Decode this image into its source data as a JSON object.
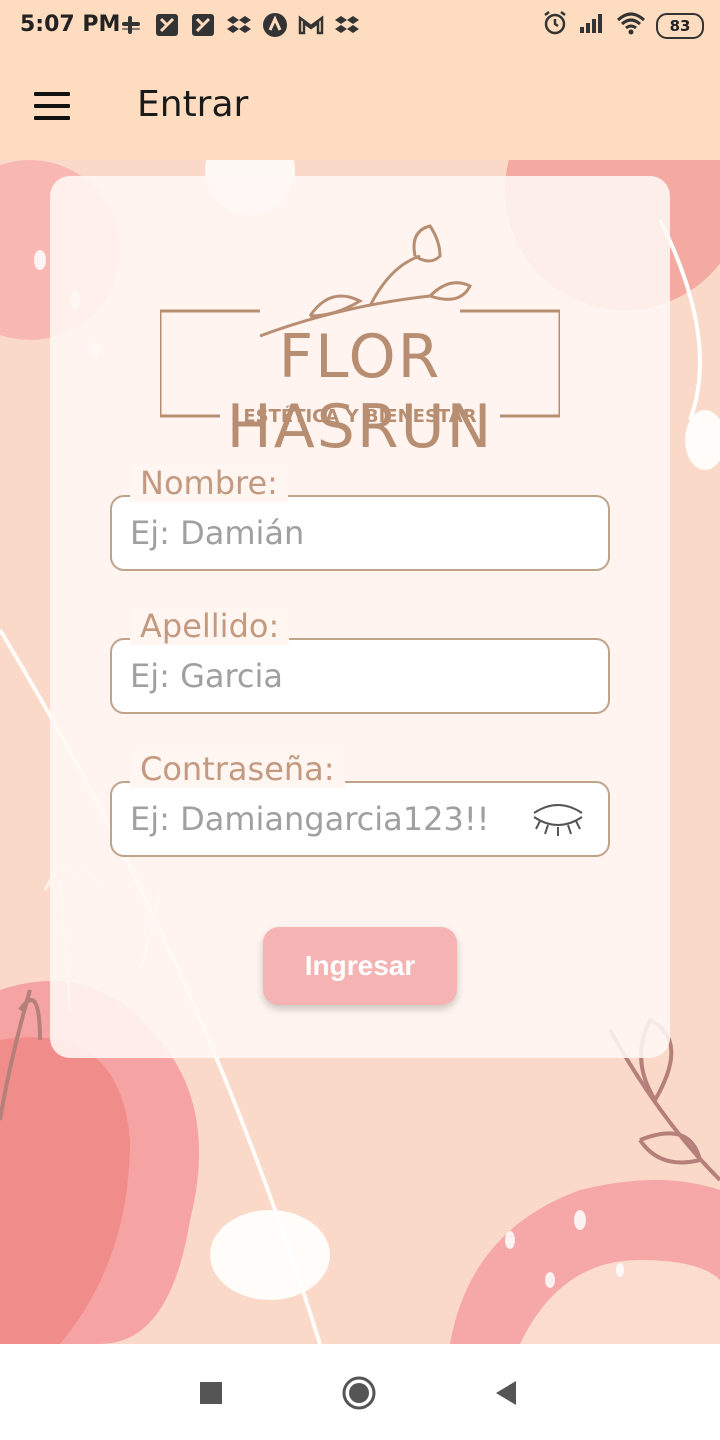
{
  "status_bar": {
    "time": "5:07 PM",
    "battery": "83",
    "icons": [
      "slack-icon",
      "app-icon",
      "app-icon",
      "dropbox-icon",
      "app-icon",
      "gmail-icon",
      "dropbox-icon",
      "alarm-icon",
      "signal-icon",
      "wifi-icon",
      "battery-icon"
    ]
  },
  "app_bar": {
    "title": "Entrar",
    "menu_icon": "hamburger-menu-icon"
  },
  "logo": {
    "name": "FLOR HASRUN",
    "tagline": "ESTÉTICA Y BIENESTAR"
  },
  "form": {
    "nombre": {
      "label": "Nombre:",
      "placeholder": "Ej: Damián",
      "value": ""
    },
    "apellido": {
      "label": "Apellido:",
      "placeholder": "Ej: Garcia",
      "value": ""
    },
    "contrasena": {
      "label": "Contraseña:",
      "placeholder": "Ej: Damiangarcia123!!",
      "value": "",
      "toggle_icon": "eye-closed-icon"
    },
    "submit_label": "Ingresar"
  },
  "nav_bar": {
    "buttons": [
      "recents-square-icon",
      "home-circle-icon",
      "back-triangle-icon"
    ]
  },
  "colors": {
    "app_bar_bg": "#fddcbf",
    "content_bg": "#fbd9c8",
    "label_color": "#c39a80",
    "field_border": "#c0a38b",
    "button_bg": "#f5b3b3"
  }
}
